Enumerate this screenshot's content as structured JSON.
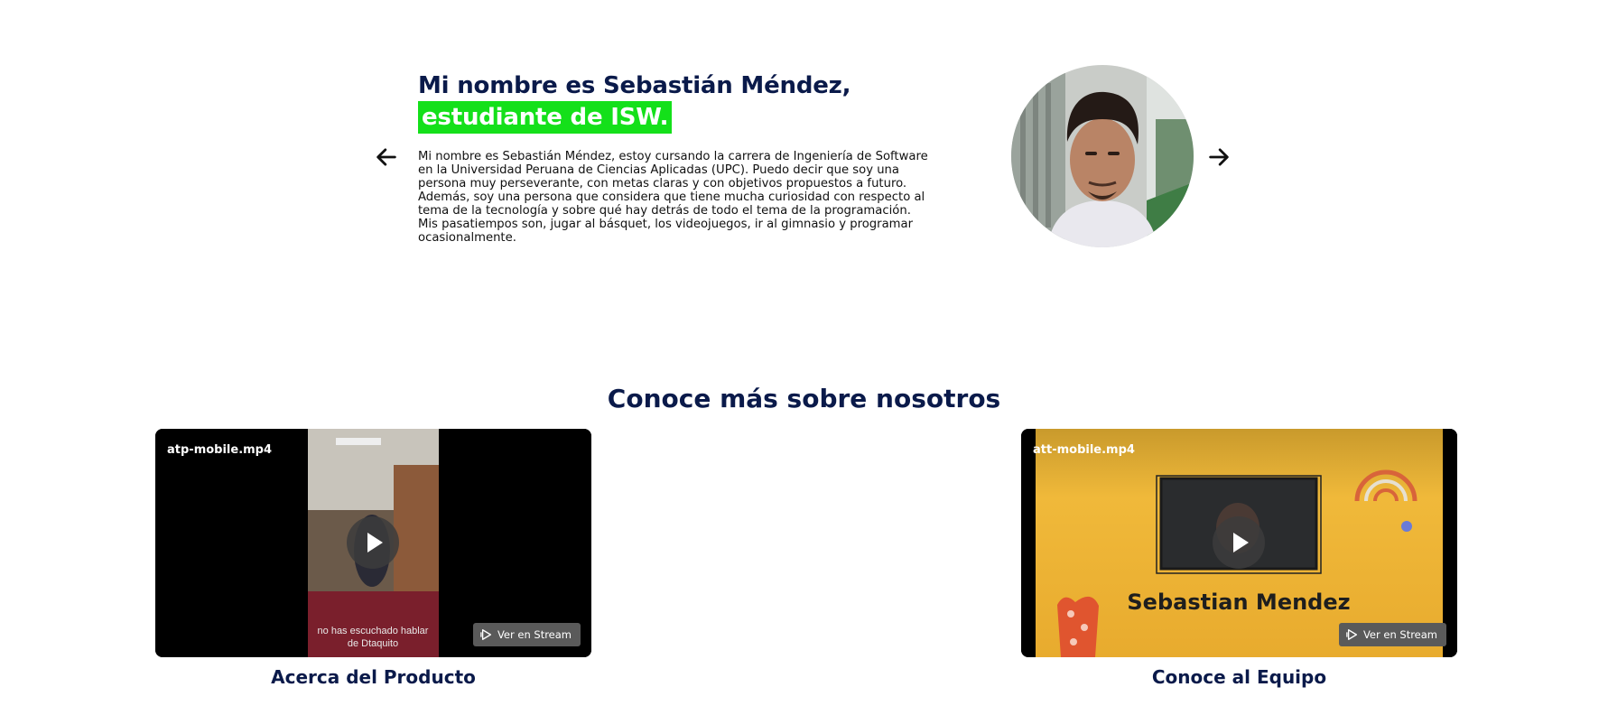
{
  "hero": {
    "title_line1": "Mi nombre es Sebastián Méndez,",
    "title_highlight": "estudiante de ISW.",
    "description": "Mi nombre es Sebastián Méndez, estoy cursando la carrera de Ingeniería de Software en la Universidad Peruana de Ciencias Aplicadas (UPC). Puedo decir que soy una persona muy perseverante, con metas claras y con objetivos propuestos a futuro. Además, soy una persona que considera que tiene mucha curiosidad con respecto al tema de la tecnología y sobre qué hay detrás de todo el tema de la programación. Mis pasatiempos son, jugar al básquet, los videojuegos, ir al gimnasio y programar ocasionalmente.",
    "prev_icon": "arrow-left-icon",
    "next_icon": "arrow-right-icon"
  },
  "section": {
    "title": "Conoce más sobre nosotros"
  },
  "videos": [
    {
      "filename": "atp-mobile.mp4",
      "subtitle_line1": "no has escuchado hablar",
      "subtitle_line2": "de Dtaquito",
      "stream_label": "Ver en Stream",
      "caption": "Acerca del Producto"
    },
    {
      "filename": "att-mobile.mp4",
      "overlay_text": "Sebastian Mendez",
      "stream_label": "Ver en Stream",
      "caption": "Conoce al Equipo"
    }
  ],
  "colors": {
    "navy": "#0a1a4a",
    "highlight_green": "#14e01a",
    "video_yellow": "#f0b93a"
  }
}
